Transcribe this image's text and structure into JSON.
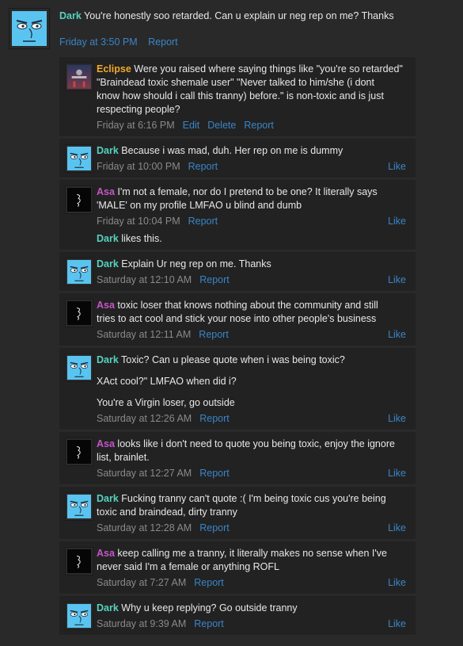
{
  "top": {
    "user": "Dark",
    "text": "You're honestly soo retarded. Can u explain ur neg rep on me? Thanks",
    "time": "Friday at 3:50 PM",
    "report": "Report"
  },
  "comments": [
    {
      "user": "Eclipse",
      "cls": "u-eclipse",
      "avatar": "eclipse",
      "lines": [
        "Were you raised where saying things like \"you're so retarded\"",
        "\"Braindead toxic shemale user\" \"Never talked to him/she (i dont",
        "know how should i call this tranny) before.\" is non-toxic and is just",
        "respecting people?"
      ],
      "time": "Friday at 6:16 PM",
      "links": [
        "Edit",
        "Delete",
        "Report"
      ],
      "like": ""
    },
    {
      "user": "Dark",
      "cls": "u-dark",
      "avatar": "dark",
      "lines": [
        "Because i was mad, duh. Her rep on me is dummy"
      ],
      "time": "Friday at 10:00 PM",
      "links": [
        "Report"
      ],
      "like": "Like"
    },
    {
      "user": "Asa",
      "cls": "u-asa",
      "avatar": "asa",
      "lines": [
        "I'm not a female, nor do I pretend to be one? It literally says",
        "'MALE' on my profile LMFAO u blind and dumb"
      ],
      "time": "Friday at 10:04 PM",
      "links": [
        "Report"
      ],
      "like": "Like",
      "likes_user": "Dark",
      "likes_text": "likes this."
    },
    {
      "user": "Dark",
      "cls": "u-dark",
      "avatar": "dark",
      "lines": [
        "Explain Ur neg rep on me. Thanks"
      ],
      "time": "Saturday at 12:10 AM",
      "links": [
        "Report"
      ],
      "like": "Like"
    },
    {
      "user": "Asa",
      "cls": "u-asa",
      "avatar": "asa",
      "lines": [
        "toxic loser that knows nothing about the community and still",
        "tries to act cool and stick your nose into other people's business"
      ],
      "time": "Saturday at 12:11 AM",
      "links": [
        "Report"
      ],
      "like": "Like"
    },
    {
      "user": "Dark",
      "cls": "u-dark",
      "avatar": "dark",
      "lines": [
        "Toxic? Can u please quote when i was being toxic?",
        "",
        "XAct cool?\" LMFAO when did i?",
        "",
        "You're a Virgin loser, go outside"
      ],
      "time": "Saturday at 12:26 AM",
      "links": [
        "Report"
      ],
      "like": "Like"
    },
    {
      "user": "Asa",
      "cls": "u-asa",
      "avatar": "asa",
      "lines": [
        "looks like i don't need to quote you being toxic, enjoy the ignore",
        "list, brainlet."
      ],
      "time": "Saturday at 12:27 AM",
      "links": [
        "Report"
      ],
      "like": "Like"
    },
    {
      "user": "Dark",
      "cls": "u-dark",
      "avatar": "dark",
      "lines": [
        "Fucking tranny can't quote :( I'm being toxic cus you're being",
        "toxic and braindead, dirty tranny"
      ],
      "time": "Saturday at 12:28 AM",
      "links": [
        "Report"
      ],
      "like": "Like"
    },
    {
      "user": "Asa",
      "cls": "u-asa",
      "avatar": "asa",
      "lines": [
        "keep calling me a tranny, it literally makes no sense when I've",
        "never said I'm a female or anything ROFL"
      ],
      "time": "Saturday at 7:27 AM",
      "links": [
        "Report"
      ],
      "like": "Like"
    },
    {
      "user": "Dark",
      "cls": "u-dark",
      "avatar": "dark",
      "lines": [
        "Why u keep replying? Go outside tranny"
      ],
      "time": "Saturday at 9:39 AM",
      "links": [
        "Report"
      ],
      "like": "Like"
    }
  ]
}
